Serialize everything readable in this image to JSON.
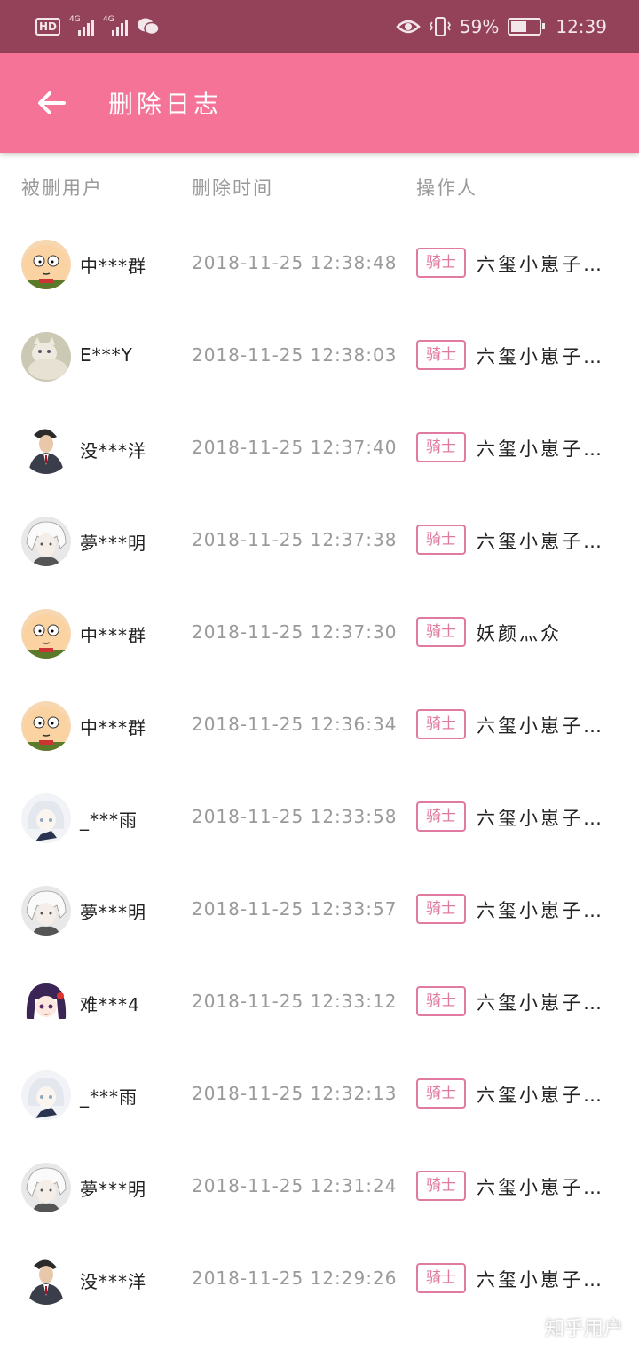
{
  "status_bar": {
    "hd_label": "HD",
    "network1": "4G",
    "network2": "4G",
    "battery_percent": "59%",
    "battery_level": 0.59,
    "time": "12:39",
    "icons": [
      "hd-icon",
      "signal-icon",
      "signal-icon",
      "wechat-icon",
      "eye-icon",
      "vibrate-icon",
      "battery-icon"
    ]
  },
  "app_bar": {
    "title": "删除日志",
    "back_icon": "back-arrow-icon",
    "color": "#f67398"
  },
  "columns": {
    "user": "被删用户",
    "time": "删除时间",
    "operator": "操作人"
  },
  "rows": [
    {
      "avatar": "cartoon-face",
      "user": "中***群",
      "time": "2018-11-25 12:38:48",
      "role": "骑士",
      "operator": "六玺小崽子…"
    },
    {
      "avatar": "cat-photo",
      "user": "E***Y",
      "time": "2018-11-25 12:38:03",
      "role": "骑士",
      "operator": "六玺小崽子…"
    },
    {
      "avatar": "suit-man",
      "user": "没***洋",
      "time": "2018-11-25 12:37:40",
      "role": "骑士",
      "operator": "六玺小崽子…"
    },
    {
      "avatar": "anime-white-hair",
      "user": "夢***明",
      "time": "2018-11-25 12:37:38",
      "role": "骑士",
      "operator": "六玺小崽子…"
    },
    {
      "avatar": "cartoon-face",
      "user": "中***群",
      "time": "2018-11-25 12:37:30",
      "role": "骑士",
      "operator": "妖颜灬众"
    },
    {
      "avatar": "cartoon-face",
      "user": "中***群",
      "time": "2018-11-25 12:36:34",
      "role": "骑士",
      "operator": "六玺小崽子…"
    },
    {
      "avatar": "anime-light",
      "user": "_***雨",
      "time": "2018-11-25 12:33:58",
      "role": "骑士",
      "operator": "六玺小崽子…"
    },
    {
      "avatar": "anime-white-hair",
      "user": "夢***明",
      "time": "2018-11-25 12:33:57",
      "role": "骑士",
      "operator": "六玺小崽子…"
    },
    {
      "avatar": "anime-purple-hair",
      "user": "难***4",
      "time": "2018-11-25 12:33:12",
      "role": "骑士",
      "operator": "六玺小崽子…"
    },
    {
      "avatar": "anime-light",
      "user": "_***雨",
      "time": "2018-11-25 12:32:13",
      "role": "骑士",
      "operator": "六玺小崽子…"
    },
    {
      "avatar": "anime-white-hair",
      "user": "夢***明",
      "time": "2018-11-25 12:31:24",
      "role": "骑士",
      "operator": "六玺小崽子…"
    },
    {
      "avatar": "suit-man",
      "user": "没***洋",
      "time": "2018-11-25 12:29:26",
      "role": "骑士",
      "operator": "六玺小崽子…"
    }
  ],
  "watermark": "知乎用户"
}
